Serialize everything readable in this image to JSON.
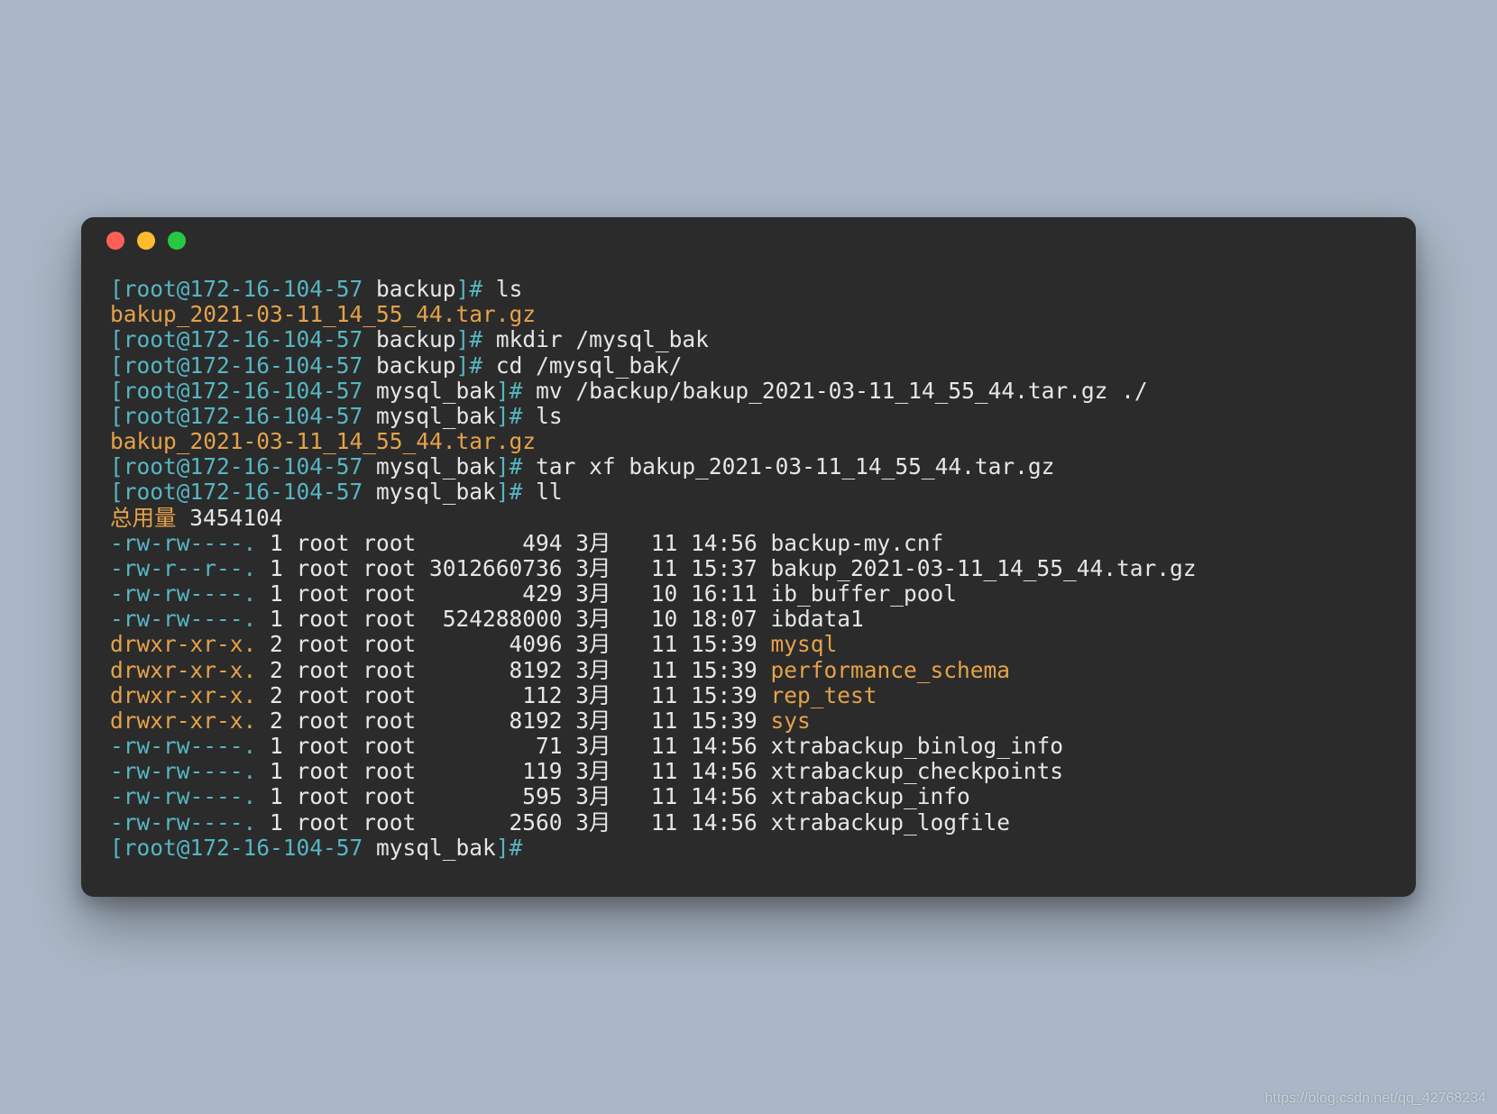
{
  "colors": {
    "bg": "#2b2b2b",
    "cyan": "#56b6c2",
    "orange": "#e5a24a",
    "white": "#e6e6e6"
  },
  "prompts": {
    "p1": {
      "bracket_open": "[",
      "user_host": "root@172-16-104-57",
      "dir": "backup",
      "bracket_close": "]#"
    },
    "p2": {
      "bracket_open": "[",
      "user_host": "root@172-16-104-57",
      "dir": "mysql_bak",
      "bracket_close": "]#"
    }
  },
  "cmds": {
    "ls1": "ls",
    "mkdir": "mkdir /mysql_bak",
    "cd": "cd /mysql_bak/",
    "mv": "mv /backup/bakup_2021-03-11_14_55_44.tar.gz ./",
    "ls2": "ls",
    "tarxf": "tar xf bakup_2021-03-11_14_55_44.tar.gz",
    "ll": "ll"
  },
  "outputs": {
    "tar1": "bakup_2021-03-11_14_55_44.tar.gz",
    "tar2": "bakup_2021-03-11_14_55_44.tar.gz",
    "total_label": "总用量",
    "total_num": "3454104"
  },
  "ll": [
    {
      "perm": "-rw-rw----.",
      "links": "1",
      "owner": "root",
      "group": "root",
      "size": "       494",
      "month": "3月",
      "day": "  11",
      "time": "14:56",
      "name": "backup-my.cnf",
      "type": "file"
    },
    {
      "perm": "-rw-r--r--.",
      "links": "1",
      "owner": "root",
      "group": "root",
      "size": "3012660736",
      "month": "3月",
      "day": "  11",
      "time": "15:37",
      "name": "bakup_2021-03-11_14_55_44.tar.gz",
      "type": "file"
    },
    {
      "perm": "-rw-rw----.",
      "links": "1",
      "owner": "root",
      "group": "root",
      "size": "       429",
      "month": "3月",
      "day": "  10",
      "time": "16:11",
      "name": "ib_buffer_pool",
      "type": "file"
    },
    {
      "perm": "-rw-rw----.",
      "links": "1",
      "owner": "root",
      "group": "root",
      "size": " 524288000",
      "month": "3月",
      "day": "  10",
      "time": "18:07",
      "name": "ibdata1",
      "type": "file"
    },
    {
      "perm": "drwxr-xr-x.",
      "links": "2",
      "owner": "root",
      "group": "root",
      "size": "      4096",
      "month": "3月",
      "day": "  11",
      "time": "15:39",
      "name": "mysql",
      "type": "dir"
    },
    {
      "perm": "drwxr-xr-x.",
      "links": "2",
      "owner": "root",
      "group": "root",
      "size": "      8192",
      "month": "3月",
      "day": "  11",
      "time": "15:39",
      "name": "performance_schema",
      "type": "dir"
    },
    {
      "perm": "drwxr-xr-x.",
      "links": "2",
      "owner": "root",
      "group": "root",
      "size": "       112",
      "month": "3月",
      "day": "  11",
      "time": "15:39",
      "name": "rep_test",
      "type": "dir"
    },
    {
      "perm": "drwxr-xr-x.",
      "links": "2",
      "owner": "root",
      "group": "root",
      "size": "      8192",
      "month": "3月",
      "day": "  11",
      "time": "15:39",
      "name": "sys",
      "type": "dir"
    },
    {
      "perm": "-rw-rw----.",
      "links": "1",
      "owner": "root",
      "group": "root",
      "size": "        71",
      "month": "3月",
      "day": "  11",
      "time": "14:56",
      "name": "xtrabackup_binlog_info",
      "type": "file"
    },
    {
      "perm": "-rw-rw----.",
      "links": "1",
      "owner": "root",
      "group": "root",
      "size": "       119",
      "month": "3月",
      "day": "  11",
      "time": "14:56",
      "name": "xtrabackup_checkpoints",
      "type": "file"
    },
    {
      "perm": "-rw-rw----.",
      "links": "1",
      "owner": "root",
      "group": "root",
      "size": "       595",
      "month": "3月",
      "day": "  11",
      "time": "14:56",
      "name": "xtrabackup_info",
      "type": "file"
    },
    {
      "perm": "-rw-rw----.",
      "links": "1",
      "owner": "root",
      "group": "root",
      "size": "      2560",
      "month": "3月",
      "day": "  11",
      "time": "14:56",
      "name": "xtrabackup_logfile",
      "type": "file"
    }
  ],
  "watermark": "https://blog.csdn.net/qq_42768234"
}
